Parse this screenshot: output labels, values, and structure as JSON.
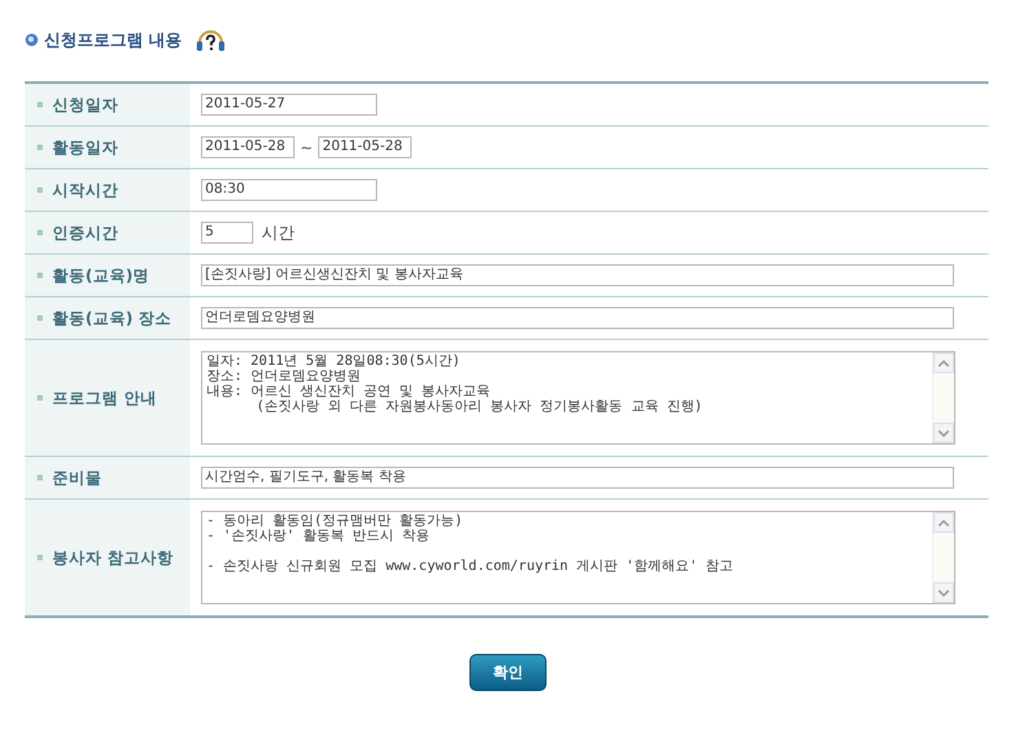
{
  "title": "신청프로그램 내용",
  "rows": [
    {
      "label": "신청일자",
      "kind": "field",
      "value": "2011-05-27"
    },
    {
      "label": "활동일자",
      "kind": "range",
      "value": "2011-05-28",
      "separator": "~",
      "value_end": "2011-05-28"
    },
    {
      "label": "시작시간",
      "kind": "field",
      "value": "08:30"
    },
    {
      "label": "인증시간",
      "kind": "hours",
      "value": "5",
      "unit": "시간"
    },
    {
      "label": "활동(교육)명",
      "kind": "wide",
      "value": "[손짓사랑] 어르신생신잔치 및 봉사자교육"
    },
    {
      "label": "활동(교육) 장소",
      "kind": "wide",
      "value": "언더로뎀요양병원"
    },
    {
      "label": "프로그램 안내",
      "kind": "textarea",
      "paragraphs": [
        [
          "일자: 2011년 5월 28일08:30(5시간)",
          "장소: 언더로뎀요양병원",
          "내용: 어르신 생신잔치 공연 및 봉사자교육",
          "      (손짓사랑 외 다른 자원봉사동아리 봉사자 정기봉사활동 교육 진행)"
        ]
      ]
    },
    {
      "label": "준비물",
      "kind": "wide",
      "value": "시간엄수, 필기도구, 활동복 착용"
    },
    {
      "label": "봉사자 참고사항",
      "kind": "textarea",
      "paragraphs": [
        [
          "- 동아리 활동임(정규맴버만 활동가능)",
          "- '손짓사랑' 활동복 반드시 착용"
        ],
        [
          "- 손짓사랑 신규회원 모집 www.cyworld.com/ruyrin 게시판 '함께해요' 참고"
        ]
      ]
    }
  ],
  "confirm_button": "확인"
}
